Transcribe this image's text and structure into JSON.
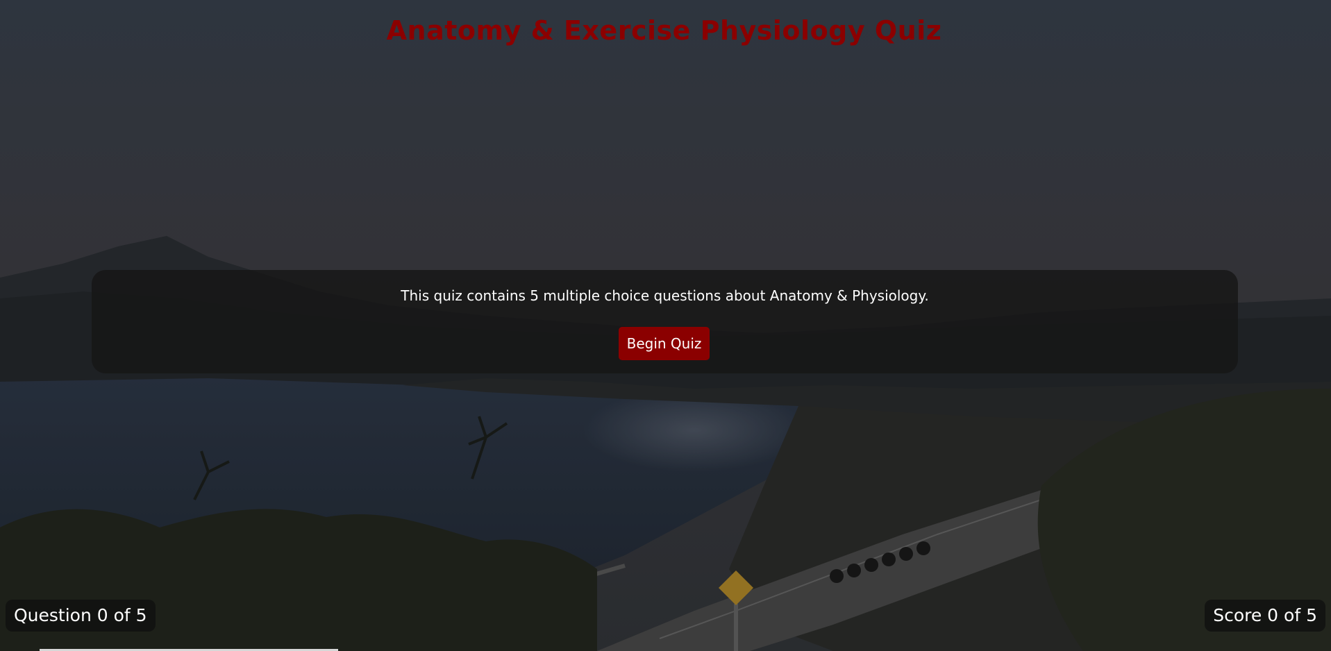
{
  "page": {
    "title": "Anatomy & Exercise Physiology Quiz"
  },
  "intro": {
    "description": "This quiz contains 5 multiple choice questions about Anatomy & Physiology.",
    "begin_label": "Begin Quiz"
  },
  "status": {
    "question_counter": "Question 0 of 5",
    "score_counter": "Score 0 of 5",
    "current_question": 0,
    "total_questions": 5,
    "score": 0
  },
  "colors": {
    "accent": "#8b0000",
    "panel": "#161616",
    "text": "#ffffff"
  },
  "background": {
    "scene": "lakeside road with group of cyclists and curve warning sign"
  }
}
